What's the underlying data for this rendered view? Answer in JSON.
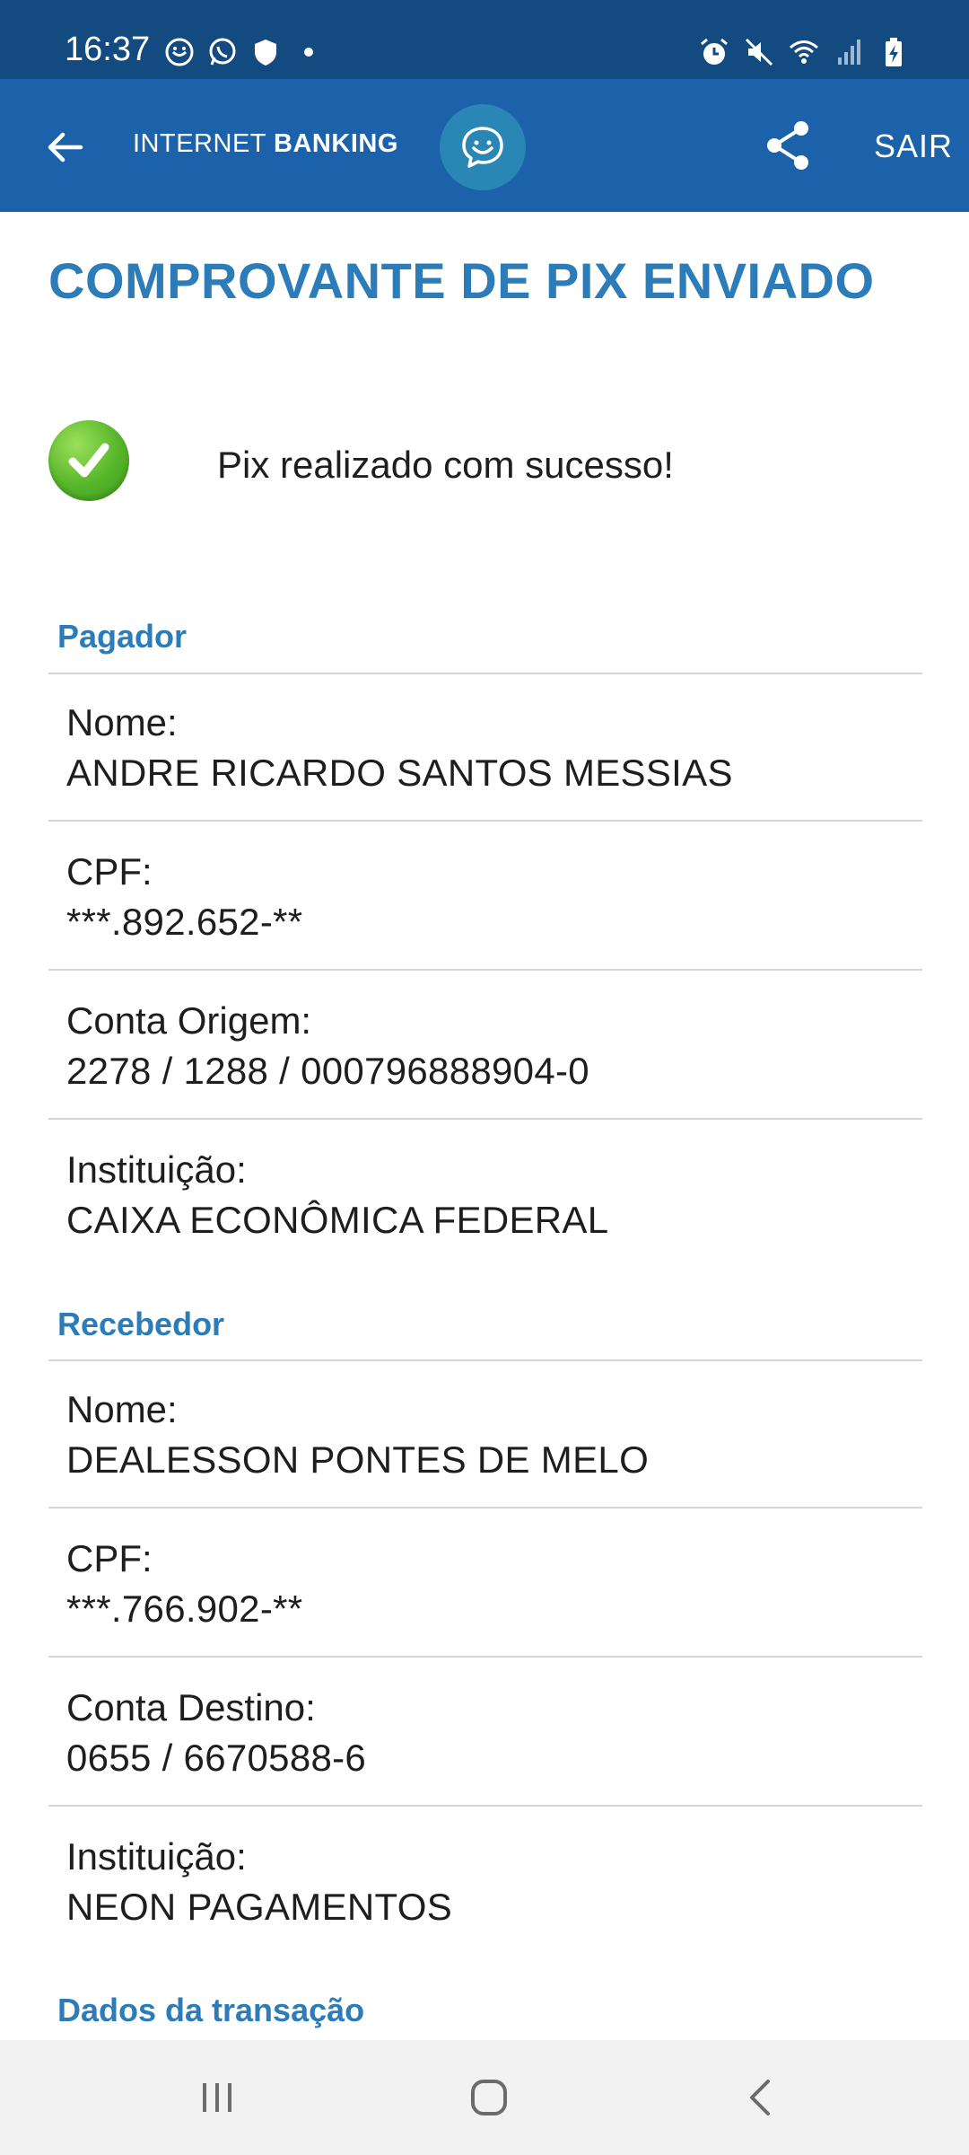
{
  "status_bar": {
    "time": "16:37",
    "left_icons": [
      "chat-bubble-icon",
      "whatsapp-icon",
      "shield-icon",
      "notification-dot-icon"
    ],
    "right_icons": [
      "alarm-icon",
      "mute-icon",
      "wifi-icon",
      "signal-icon",
      "battery-charging-icon"
    ]
  },
  "app_bar": {
    "brand_light": "INTERNET",
    "brand_bold": "BANKING",
    "exit_label": "SAIR"
  },
  "page": {
    "title": "COMPROVANTE DE PIX ENVIADO",
    "success_message": "Pix realizado com sucesso!"
  },
  "payer": {
    "section_title": "Pagador",
    "fields": [
      {
        "label": "Nome:",
        "value": "ANDRE RICARDO SANTOS MESSIAS"
      },
      {
        "label": "CPF:",
        "value": "***.892.652-**"
      },
      {
        "label": "Conta Origem:",
        "value": "2278 / 1288 / 000796888904-0"
      },
      {
        "label": "Instituição:",
        "value": "CAIXA ECONÔMICA FEDERAL"
      }
    ]
  },
  "receiver": {
    "section_title": "Recebedor",
    "fields": [
      {
        "label": "Nome:",
        "value": "DEALESSON PONTES DE MELO"
      },
      {
        "label": "CPF:",
        "value": "***.766.902-**"
      },
      {
        "label": "Conta Destino:",
        "value": "0655 / 6670588-6"
      },
      {
        "label": "Instituição:",
        "value": "NEON PAGAMENTOS"
      }
    ]
  },
  "transaction": {
    "section_title": "Dados da transação"
  },
  "colors": {
    "status_bar": "#134a80",
    "app_bar": "#1c62aa",
    "accent": "#2b7cb8",
    "success_green": "#56b52a"
  }
}
